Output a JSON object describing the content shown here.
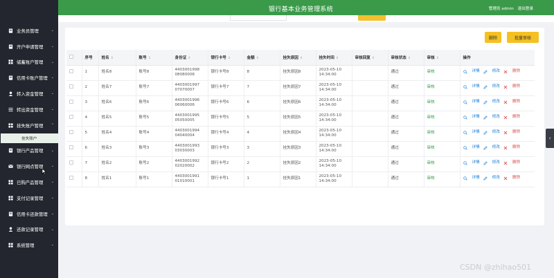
{
  "header": {
    "title": "银行基本业务管理系统",
    "user": "管理员 admin",
    "logout": "退出登录"
  },
  "sidebar": {
    "items": [
      {
        "label": "业务员管理",
        "icon": "document-icon"
      },
      {
        "label": "开户申请管理",
        "icon": "document-icon"
      },
      {
        "label": "储蓄账户管理",
        "icon": "grid-icon"
      },
      {
        "label": "信用卡账户管理",
        "icon": "document-icon"
      },
      {
        "label": "转入资金管理",
        "icon": "user-icon"
      },
      {
        "label": "转出资金管理",
        "icon": "list-icon"
      },
      {
        "label": "挂失账户管理",
        "icon": "grid-icon"
      }
    ],
    "sub": "挂失账户",
    "items2": [
      {
        "label": "银行产品管理",
        "icon": "document-icon"
      },
      {
        "label": "银行网点管理",
        "icon": "envelope-icon"
      },
      {
        "label": "已购产品管理",
        "icon": "grid-icon"
      },
      {
        "label": "支付记录管理",
        "icon": "grid-icon"
      },
      {
        "label": "信用卡还款管理",
        "icon": "document-icon"
      },
      {
        "label": "还款记录管理",
        "icon": "user-icon"
      },
      {
        "label": "系统管理",
        "icon": "grid-icon"
      }
    ]
  },
  "toolbar": {
    "delete": "删除",
    "batch_audit": "批量审核"
  },
  "table": {
    "headers": [
      "序号",
      "姓名",
      "账号",
      "身份证",
      "银行卡号",
      "金额",
      "挂失原因",
      "挂失时间",
      "审核回复",
      "审核状态",
      "审核",
      "操作"
    ],
    "rows": [
      {
        "no": "1",
        "name": "姓名8",
        "acct": "账号8",
        "id1": "4403001998",
        "id2": "08080008",
        "card": "银行卡号8",
        "amount": "8",
        "reason": "挂失原因8",
        "date": "2023-05-10",
        "time": "14:34:00",
        "status": "通过",
        "audit": "审核"
      },
      {
        "no": "2",
        "name": "姓名7",
        "acct": "账号7",
        "id1": "4403001997",
        "id2": "07070007",
        "card": "银行卡号7",
        "amount": "7",
        "reason": "挂失原因7",
        "date": "2023-05-10",
        "time": "14:34:00",
        "status": "通过",
        "audit": "审核"
      },
      {
        "no": "3",
        "name": "姓名6",
        "acct": "账号6",
        "id1": "4403001996",
        "id2": "06060006",
        "card": "银行卡号6",
        "amount": "6",
        "reason": "挂失原因6",
        "date": "2023-05-10",
        "time": "14:34:00",
        "status": "通过",
        "audit": "审核"
      },
      {
        "no": "4",
        "name": "姓名5",
        "acct": "账号5",
        "id1": "4403001995",
        "id2": "05050005",
        "card": "银行卡号5",
        "amount": "5",
        "reason": "挂失原因5",
        "date": "2023-05-10",
        "time": "14:34:00",
        "status": "通过",
        "audit": "审核"
      },
      {
        "no": "5",
        "name": "姓名4",
        "acct": "账号4",
        "id1": "4403001994",
        "id2": "04040004",
        "card": "银行卡号4",
        "amount": "4",
        "reason": "挂失原因4",
        "date": "2023-05-10",
        "time": "14:34:00",
        "status": "通过",
        "audit": "审核"
      },
      {
        "no": "6",
        "name": "姓名3",
        "acct": "账号3",
        "id1": "4403001993",
        "id2": "03030003",
        "card": "银行卡号3",
        "amount": "3",
        "reason": "挂失原因3",
        "date": "2023-05-10",
        "time": "14:34:00",
        "status": "通过",
        "audit": "审核"
      },
      {
        "no": "7",
        "name": "姓名2",
        "acct": "账号2",
        "id1": "4403001992",
        "id2": "02020002",
        "card": "银行卡号2",
        "amount": "2",
        "reason": "挂失原因2",
        "date": "2023-05-10",
        "time": "14:34:00",
        "status": "通过",
        "audit": "审核"
      },
      {
        "no": "8",
        "name": "姓名1",
        "acct": "账号1",
        "id1": "4403001991",
        "id2": "01010001",
        "card": "银行卡号1",
        "amount": "1",
        "reason": "挂失原因1",
        "date": "2023-05-10",
        "time": "14:34:00",
        "status": "通过",
        "audit": "审核"
      }
    ],
    "ops": {
      "detail": "详情",
      "edit": "修改",
      "del": "删除"
    }
  },
  "watermark": "CSDN @zhihao501",
  "colors": {
    "sidebar": "#23262e",
    "header": "#3b9a4a",
    "button": "#f5c022",
    "link": "#1e80d8",
    "danger": "#d9534f"
  }
}
